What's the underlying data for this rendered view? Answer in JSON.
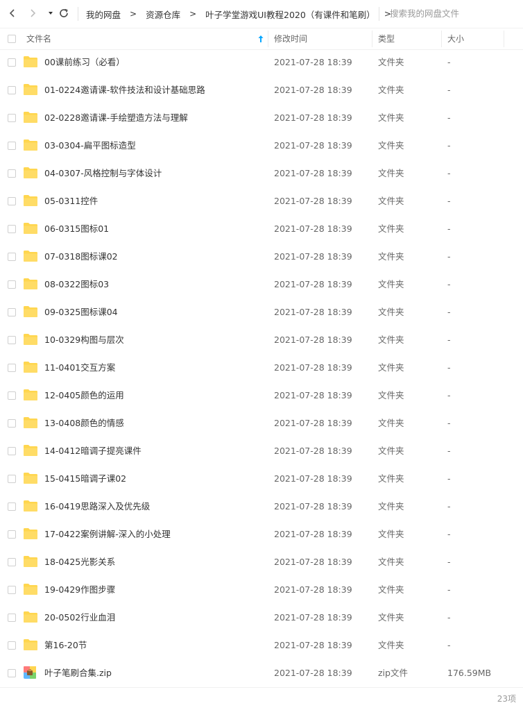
{
  "nav": {
    "back_icon": "chevron-left-icon",
    "forward_icon": "chevron-right-icon",
    "dropdown_icon": "caret-down-icon",
    "refresh_icon": "refresh-icon"
  },
  "breadcrumb": {
    "items": [
      "我的网盘",
      "资源仓库",
      "叶子学堂游戏UI教程2020（有课件和笔刷）"
    ],
    "separator": ">"
  },
  "search": {
    "placeholder": "搜索我的网盘文件"
  },
  "columns": {
    "name": "文件名",
    "modified": "修改时间",
    "type": "类型",
    "size": "大小",
    "sort_icon": "sort-ascending-arrow-icon"
  },
  "colors": {
    "folder": "#FFD64F",
    "accent": "#06a7ff"
  },
  "files": [
    {
      "name": "00课前练习（必看）",
      "modified": "2021-07-28 18:39",
      "type": "文件夹",
      "size": "-",
      "icon": "folder-icon"
    },
    {
      "name": "01-0224邀请课-软件技法和设计基础思路",
      "modified": "2021-07-28 18:39",
      "type": "文件夹",
      "size": "-",
      "icon": "folder-icon"
    },
    {
      "name": "02-0228邀请课-手绘塑造方法与理解",
      "modified": "2021-07-28 18:39",
      "type": "文件夹",
      "size": "-",
      "icon": "folder-icon"
    },
    {
      "name": "03-0304-扁平图标造型",
      "modified": "2021-07-28 18:39",
      "type": "文件夹",
      "size": "-",
      "icon": "folder-icon"
    },
    {
      "name": "04-0307-风格控制与字体设计",
      "modified": "2021-07-28 18:39",
      "type": "文件夹",
      "size": "-",
      "icon": "folder-icon"
    },
    {
      "name": "05-0311控件",
      "modified": "2021-07-28 18:39",
      "type": "文件夹",
      "size": "-",
      "icon": "folder-icon"
    },
    {
      "name": "06-0315图标01",
      "modified": "2021-07-28 18:39",
      "type": "文件夹",
      "size": "-",
      "icon": "folder-icon"
    },
    {
      "name": "07-0318图标课02",
      "modified": "2021-07-28 18:39",
      "type": "文件夹",
      "size": "-",
      "icon": "folder-icon"
    },
    {
      "name": "08-0322图标03",
      "modified": "2021-07-28 18:39",
      "type": "文件夹",
      "size": "-",
      "icon": "folder-icon"
    },
    {
      "name": "09-0325图标课04",
      "modified": "2021-07-28 18:39",
      "type": "文件夹",
      "size": "-",
      "icon": "folder-icon"
    },
    {
      "name": "10-0329构图与层次",
      "modified": "2021-07-28 18:39",
      "type": "文件夹",
      "size": "-",
      "icon": "folder-icon"
    },
    {
      "name": "11-0401交互方案",
      "modified": "2021-07-28 18:39",
      "type": "文件夹",
      "size": "-",
      "icon": "folder-icon"
    },
    {
      "name": "12-0405颜色的运用",
      "modified": "2021-07-28 18:39",
      "type": "文件夹",
      "size": "-",
      "icon": "folder-icon"
    },
    {
      "name": "13-0408颜色的情感",
      "modified": "2021-07-28 18:39",
      "type": "文件夹",
      "size": "-",
      "icon": "folder-icon"
    },
    {
      "name": "14-0412暗调子提亮课件",
      "modified": "2021-07-28 18:39",
      "type": "文件夹",
      "size": "-",
      "icon": "folder-icon"
    },
    {
      "name": "15-0415暗调子课02",
      "modified": "2021-07-28 18:39",
      "type": "文件夹",
      "size": "-",
      "icon": "folder-icon"
    },
    {
      "name": "16-0419思路深入及优先级",
      "modified": "2021-07-28 18:39",
      "type": "文件夹",
      "size": "-",
      "icon": "folder-icon"
    },
    {
      "name": "17-0422案例讲解-深入的小处理",
      "modified": "2021-07-28 18:39",
      "type": "文件夹",
      "size": "-",
      "icon": "folder-icon"
    },
    {
      "name": "18-0425光影关系",
      "modified": "2021-07-28 18:39",
      "type": "文件夹",
      "size": "-",
      "icon": "folder-icon"
    },
    {
      "name": "19-0429作图步骤",
      "modified": "2021-07-28 18:39",
      "type": "文件夹",
      "size": "-",
      "icon": "folder-icon"
    },
    {
      "name": "20-0502行业血泪",
      "modified": "2021-07-28 18:39",
      "type": "文件夹",
      "size": "-",
      "icon": "folder-icon"
    },
    {
      "name": "第16-20节",
      "modified": "2021-07-28 18:39",
      "type": "文件夹",
      "size": "-",
      "icon": "folder-icon"
    },
    {
      "name": "叶子笔刷合集.zip",
      "modified": "2021-07-28 18:39",
      "type": "zip文件",
      "size": "176.59MB",
      "icon": "zip-archive-icon"
    }
  ],
  "footer": {
    "count": "23项"
  }
}
